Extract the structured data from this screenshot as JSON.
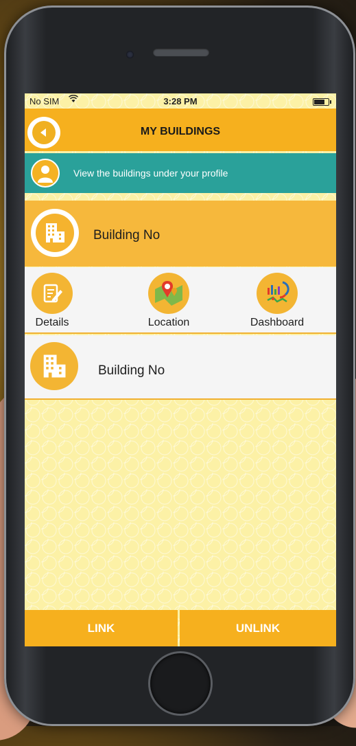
{
  "status_bar": {
    "carrier": "No SIM",
    "time": "3:28 PM",
    "battery_level": 0.85
  },
  "header": {
    "title": "MY BUILDINGS",
    "back_icon": "back-arrow-icon"
  },
  "info_banner": {
    "text": "View the buildings under your profile",
    "icon": "profile-icon"
  },
  "buildings": [
    {
      "name": "Building No",
      "icon": "building-icon"
    },
    {
      "name": "Building No",
      "icon": "building-icon"
    }
  ],
  "actions": [
    {
      "label": "Details",
      "icon": "details-edit-icon"
    },
    {
      "label": "Location",
      "icon": "map-location-icon"
    },
    {
      "label": "Dashboard",
      "icon": "dashboard-chart-icon"
    }
  ],
  "bottom_bar": {
    "link_label": "LINK",
    "unlink_label": "UNLINK"
  },
  "colors": {
    "accent": "#f6b01e",
    "teal": "#2aa19a",
    "card": "#f6b83c",
    "background": "#fcf1a6"
  }
}
